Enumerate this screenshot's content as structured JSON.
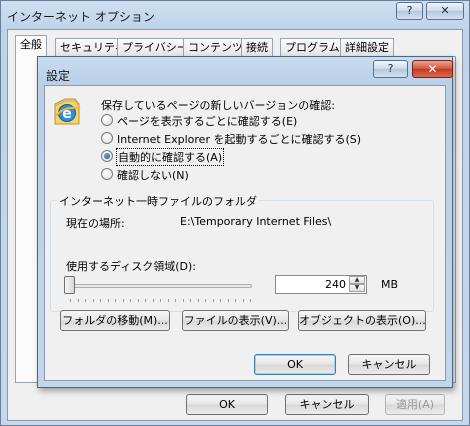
{
  "outer": {
    "title": "インターネット オプション",
    "help_label": "?",
    "close_label": "✕",
    "tabs": [
      "全般",
      "セキュリティ",
      "プライバシー",
      "コンテンツ",
      "接続",
      "プログラム",
      "詳細設定"
    ],
    "buttons": {
      "ok": "OK",
      "cancel": "キャンセル",
      "apply": "適用(A)"
    }
  },
  "dialog": {
    "title": "設定",
    "help_label": "?",
    "close_label": "✕",
    "check_label": "保存しているページの新しいバージョンの確認:",
    "radios": [
      {
        "label": "ページを表示するごとに確認する(E)",
        "checked": false
      },
      {
        "label": "Internet Explorer を起動するごとに確認する(S)",
        "checked": false
      },
      {
        "label": "自動的に確認する(A)",
        "checked": true
      },
      {
        "label": "確認しない(N)",
        "checked": false
      }
    ],
    "temp_group": {
      "legend": "インターネット一時ファイルのフォルダ",
      "location_label": "現在の場所:",
      "location_value": "E:\\Temporary Internet Files\\",
      "disk_label": "使用するディスク領域(D):",
      "disk_value": "240",
      "disk_unit": "MB",
      "slider_level": 0.0,
      "buttons": {
        "move": "フォルダの移動(M)...",
        "view_files": "ファイルの表示(V)...",
        "view_objects": "オブジェクトの表示(O)..."
      }
    },
    "buttons": {
      "ok": "OK",
      "cancel": "キャンセル"
    }
  },
  "icons": {
    "ie": "internet-explorer-icon",
    "spin_up": "spin-up-icon",
    "spin_down": "spin-down-icon"
  }
}
